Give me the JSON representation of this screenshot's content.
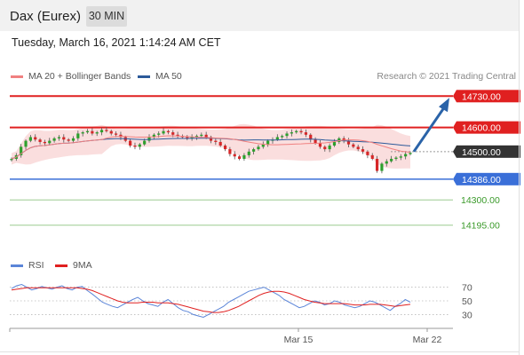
{
  "header": {
    "title": "Dax (Eurex)",
    "timeframe": "30 MIN"
  },
  "timestamp": "Tuesday, March 16, 2021 1:14:24 AM CET",
  "legend": {
    "ma20_label": "MA 20 + Bollinger Bands",
    "ma50_label": "MA 50",
    "copyright": "Research © 2021 Trading Central"
  },
  "rsi_legend": {
    "rsi_label": "RSI",
    "ma_label": "9MA"
  },
  "colors": {
    "resistance": "#e02020",
    "support": "#3a6fd8",
    "current": "#333333",
    "target": "#3a9a2a",
    "bollinger": "#f7c8c8",
    "ma20": "#f08080",
    "ma50": "#2c5a9a",
    "candle_up": "#2ca02c",
    "candle_down": "#d62728",
    "arrow": "#2a63a8",
    "rsi": "#5b85d8",
    "rsi_ma": "#e02020"
  },
  "chart_data": [
    {
      "type": "candlestick",
      "title": "Dax (Eurex)",
      "timeframe": "30 MIN",
      "xlabel": "",
      "ylabel": "",
      "x_ticks": [
        "Mar 15",
        "Mar 22"
      ],
      "ylim": [
        14080,
        14790
      ],
      "current_price": 14500.0,
      "price_levels": [
        {
          "label": "14730.00",
          "value": 14730.0,
          "kind": "resistance"
        },
        {
          "label": "14600.00",
          "value": 14600.0,
          "kind": "resistance"
        },
        {
          "label": "14500.00",
          "value": 14500.0,
          "kind": "current"
        },
        {
          "label": "14386.00",
          "value": 14386.0,
          "kind": "support"
        },
        {
          "label": "14300.00",
          "value": 14300.0,
          "kind": "target"
        },
        {
          "label": "14195.00",
          "value": 14195.0,
          "kind": "target"
        }
      ],
      "series": [
        {
          "name": "MA 20 + Bollinger Bands"
        },
        {
          "name": "MA 50"
        }
      ],
      "close": [
        14470,
        14485,
        14520,
        14545,
        14560,
        14550,
        14540,
        14535,
        14545,
        14555,
        14560,
        14550,
        14545,
        14555,
        14575,
        14580,
        14585,
        14575,
        14580,
        14590,
        14585,
        14575,
        14570,
        14560,
        14545,
        14525,
        14520,
        14530,
        14545,
        14560,
        14570,
        14575,
        14585,
        14580,
        14570,
        14565,
        14560,
        14555,
        14560,
        14565,
        14570,
        14560,
        14545,
        14540,
        14525,
        14510,
        14490,
        14480,
        14470,
        14485,
        14500,
        14510,
        14520,
        14530,
        14545,
        14550,
        14560,
        14565,
        14575,
        14580,
        14585,
        14580,
        14570,
        14550,
        14535,
        14520,
        14510,
        14525,
        14540,
        14555,
        14545,
        14530,
        14520,
        14510,
        14500,
        14485,
        14470,
        14420,
        14450,
        14460,
        14470,
        14475,
        14480,
        14490,
        14495
      ],
      "forecast_arrow": {
        "from": 14500,
        "to": 14730
      }
    },
    {
      "type": "line",
      "title": "RSI",
      "ylim": [
        15,
        85
      ],
      "y_ticks": [
        "70",
        "50",
        "30"
      ],
      "x_ticks": [
        "Mar 15",
        "Mar 22"
      ],
      "series": [
        {
          "name": "RSI",
          "values": [
            68,
            72,
            74,
            70,
            66,
            68,
            71,
            69,
            67,
            70,
            72,
            68,
            66,
            70,
            71,
            65,
            60,
            54,
            48,
            45,
            42,
            40,
            44,
            48,
            52,
            55,
            50,
            46,
            44,
            42,
            48,
            52,
            46,
            40,
            36,
            34,
            30,
            28,
            26,
            30,
            34,
            38,
            42,
            48,
            52,
            56,
            60,
            64,
            66,
            68,
            70,
            66,
            62,
            58,
            52,
            48,
            44,
            40,
            42,
            46,
            50,
            48,
            44,
            46,
            50,
            48,
            44,
            42,
            40,
            42,
            46,
            50,
            48,
            44,
            40,
            36,
            42,
            46,
            52,
            48
          ]
        },
        {
          "name": "9MA",
          "values": [
            66,
            67,
            68,
            69,
            69,
            69,
            69,
            69,
            69,
            69,
            69,
            69,
            69,
            69,
            68,
            67,
            65,
            62,
            59,
            56,
            53,
            50,
            48,
            47,
            47,
            47,
            48,
            48,
            48,
            47,
            47,
            47,
            46,
            45,
            43,
            41,
            39,
            37,
            35,
            34,
            33,
            33,
            34,
            36,
            39,
            42,
            46,
            50,
            54,
            58,
            61,
            63,
            64,
            64,
            63,
            61,
            58,
            55,
            52,
            50,
            48,
            47,
            46,
            46,
            46,
            46,
            46,
            45,
            44,
            44,
            44,
            45,
            45,
            45,
            44,
            43,
            42,
            43,
            44,
            45
          ]
        }
      ]
    }
  ]
}
